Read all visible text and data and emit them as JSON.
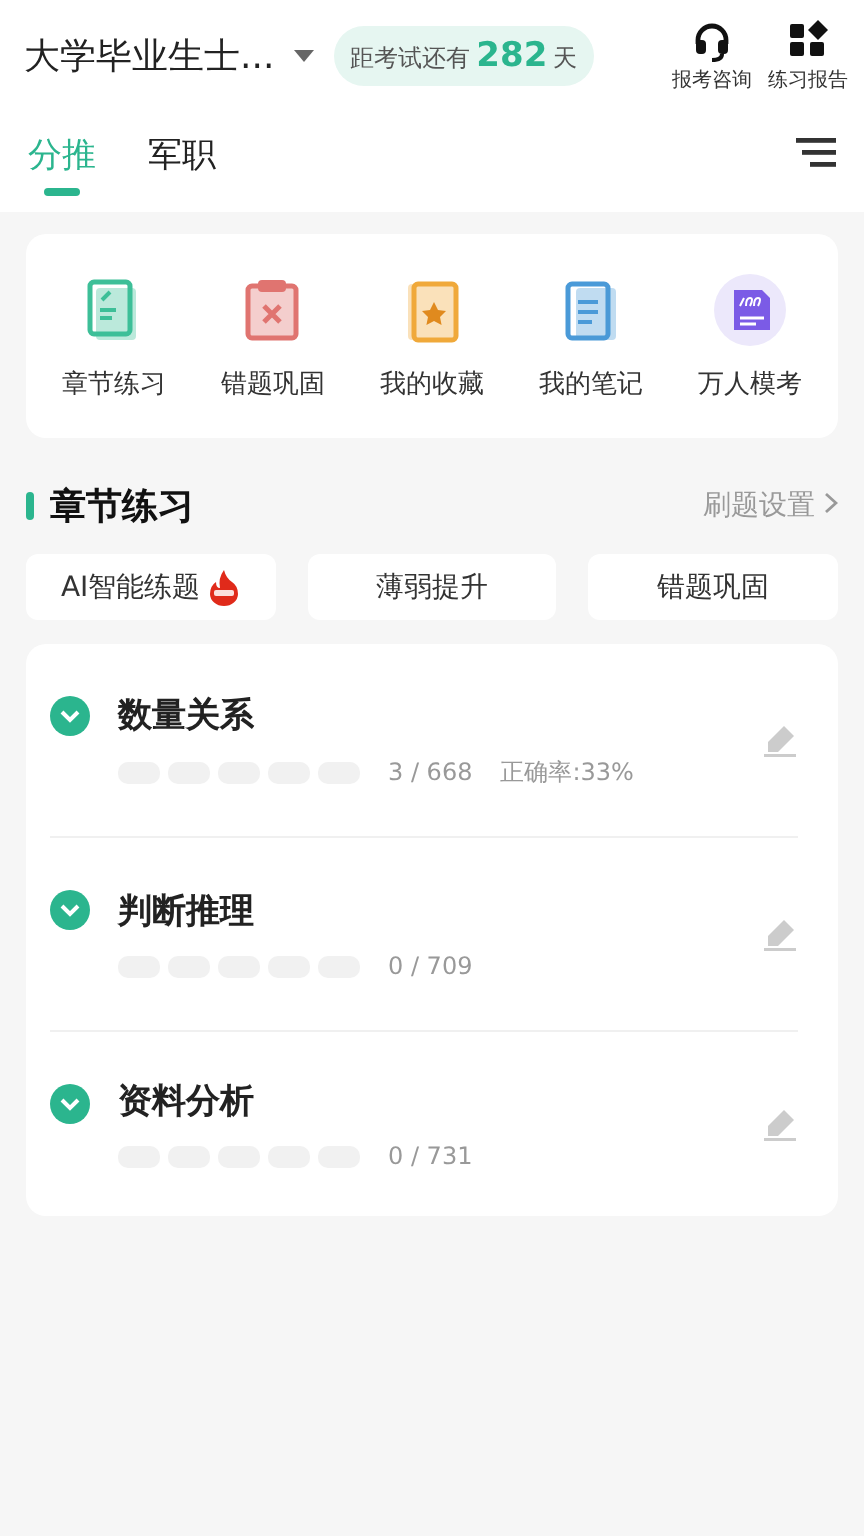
{
  "header": {
    "exam_name": "大学毕业生士...",
    "countdown": {
      "prefix": "距考试还有",
      "days": "282",
      "suffix": "天"
    },
    "actions": [
      {
        "kind": "headset",
        "label": "报考咨询"
      },
      {
        "kind": "grid",
        "label": "练习报告"
      }
    ]
  },
  "tabs": [
    {
      "label": "分推",
      "selected": true
    },
    {
      "label": "军职",
      "selected": false
    }
  ],
  "shortcuts": [
    {
      "kind": "chapter",
      "label": "章节练习",
      "color": "#3dbf98"
    },
    {
      "kind": "wrong",
      "label": "错题巩固",
      "color": "#e07470"
    },
    {
      "kind": "favorite",
      "label": "我的收藏",
      "color": "#f0a93a"
    },
    {
      "kind": "notes",
      "label": "我的笔记",
      "color": "#4a9ad8"
    },
    {
      "kind": "mock",
      "label": "万人模考",
      "color": "#7b5be6"
    }
  ],
  "section": {
    "title": "章节练习",
    "link": "刷题设置"
  },
  "modes": [
    {
      "label": "AI智能练题",
      "hot": true
    },
    {
      "label": "薄弱提升",
      "hot": false
    },
    {
      "label": "错题巩固",
      "hot": false
    }
  ],
  "chapters": [
    {
      "title": "数量关系",
      "progress": "3 / 668",
      "accuracy": "正确率:33%"
    },
    {
      "title": "判断推理",
      "progress": "0 / 709"
    },
    {
      "title": "资料分析",
      "progress": "0 / 731"
    }
  ]
}
